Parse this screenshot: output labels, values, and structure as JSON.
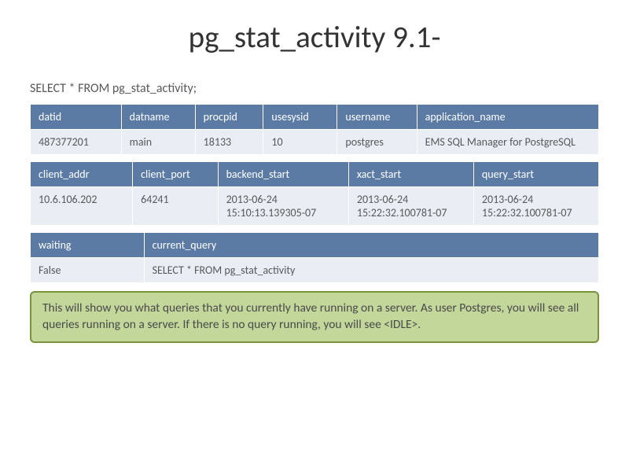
{
  "title": "pg_stat_activity 9.1-",
  "query": "SELECT * FROM pg_stat_activity;",
  "table1": {
    "headers": [
      "datid",
      "datname",
      "procpid",
      "usesysid",
      "username",
      "application_name"
    ],
    "row": [
      "487377201",
      "main",
      "18133",
      "10",
      "postgres",
      "EMS SQL Manager for PostgreSQL"
    ]
  },
  "table2": {
    "headers": [
      "client_addr",
      "client_port",
      "backend_start",
      "xact_start",
      "query_start"
    ],
    "row": [
      "10.6.106.202",
      "64241",
      "2013-06-24 15:10:13.139305-07",
      "2013-06-24 15:22:32.100781-07",
      "2013-06-24 15:22:32.100781-07"
    ]
  },
  "table3": {
    "headers": [
      "waiting",
      "current_query"
    ],
    "row": [
      "False",
      "SELECT * FROM pg_stat_activity"
    ]
  },
  "info": "This will show you what queries that you currently have running on a server. As user Postgres, you will see all queries running on a server. If there is no query running, you will see <IDLE>."
}
